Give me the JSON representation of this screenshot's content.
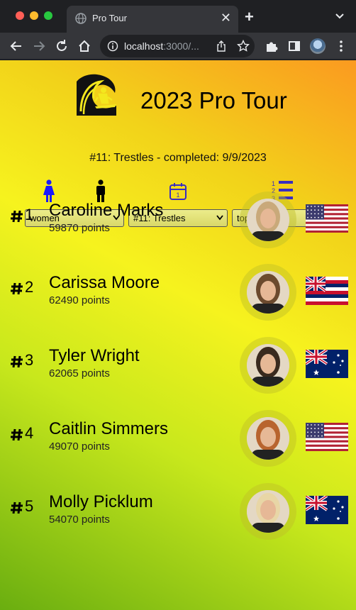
{
  "browser": {
    "tab_title": "Pro Tour",
    "url_host": "localhost",
    "url_rest": ":3000/..."
  },
  "page": {
    "title": "2023 Pro Tour",
    "event_status": "#11: Trestles - completed: 9/9/2023"
  },
  "filters": {
    "gender": {
      "selected": "women",
      "icons": [
        "women-icon",
        "men-icon"
      ]
    },
    "event": {
      "selected": "#11: Trestles",
      "icon": "calendar-icon"
    },
    "view": {
      "selected": "top five",
      "icon": "ranked-list-icon"
    }
  },
  "rankings": [
    {
      "rank": "1",
      "name": "Caroline Marks",
      "points": "59870 points",
      "flag": "usa-flag",
      "hair": "#c9a97a"
    },
    {
      "rank": "2",
      "name": "Carissa Moore",
      "points": "62490 points",
      "flag": "hawaii-flag",
      "hair": "#6b4a2e"
    },
    {
      "rank": "3",
      "name": "Tyler Wright",
      "points": "62065 points",
      "flag": "australia-flag",
      "hair": "#3a2a1e"
    },
    {
      "rank": "4",
      "name": "Caitlin Simmers",
      "points": "49070 points",
      "flag": "usa-flag",
      "hair": "#b8642e"
    },
    {
      "rank": "5",
      "name": "Molly Picklum",
      "points": "54070 points",
      "flag": "australia-flag",
      "hair": "#e8d6a6"
    }
  ],
  "colors": {
    "accent_blue": "#1a1aff",
    "icon_purple": "#3a2dbf"
  }
}
